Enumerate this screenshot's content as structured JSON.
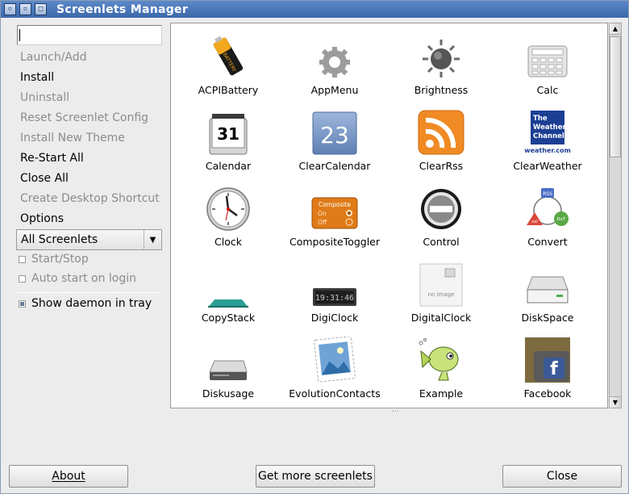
{
  "window": {
    "title": "Screenlets Manager"
  },
  "search": {
    "value": ""
  },
  "actions": [
    {
      "label": "Launch/Add",
      "enabled": false
    },
    {
      "label": "Install",
      "enabled": true
    },
    {
      "label": "Uninstall",
      "enabled": false
    },
    {
      "label": "Reset Screenlet Config",
      "enabled": false
    },
    {
      "label": "Install New Theme",
      "enabled": false
    },
    {
      "label": "Re-Start All",
      "enabled": true
    },
    {
      "label": "Close All",
      "enabled": true
    },
    {
      "label": "Create Desktop Shortcut",
      "enabled": false
    },
    {
      "label": "Options",
      "enabled": true
    }
  ],
  "filter": {
    "selected": "All Screenlets"
  },
  "options": {
    "start_stop": {
      "label": "Start/Stop",
      "checked": false,
      "enabled": false
    },
    "auto_start": {
      "label": "Auto start on login",
      "checked": false,
      "enabled": false
    },
    "show_daemon": {
      "label": "Show daemon in tray",
      "checked": true,
      "enabled": true
    }
  },
  "screenlets": [
    {
      "label": "ACPIBattery",
      "icon": "battery-icon"
    },
    {
      "label": "AppMenu",
      "icon": "gear-icon"
    },
    {
      "label": "Brightness",
      "icon": "sun-icon"
    },
    {
      "label": "Calc",
      "icon": "calculator-icon"
    },
    {
      "label": "Calendar",
      "icon": "calendar-page-icon",
      "icon_text": "31"
    },
    {
      "label": "ClearCalendar",
      "icon": "clear-calendar-icon",
      "icon_text": "23"
    },
    {
      "label": "ClearRss",
      "icon": "rss-icon"
    },
    {
      "label": "ClearWeather",
      "icon": "weather-channel-icon",
      "icon_text": "The Weather Channel",
      "icon_subtext": "weather.com"
    },
    {
      "label": "Clock",
      "icon": "clock-icon"
    },
    {
      "label": "CompositeToggler",
      "icon": "composite-toggle-icon",
      "icon_text": "Composite",
      "icon_on": "On",
      "icon_off": "Off"
    },
    {
      "label": "Control",
      "icon": "minus-circle-icon"
    },
    {
      "label": "Convert",
      "icon": "convert-cycle-icon",
      "icon_a": "RSS",
      "icon_b": "xsl",
      "icon_c": "RxT"
    },
    {
      "label": "CopyStack",
      "icon": "copystack-icon"
    },
    {
      "label": "DigiClock",
      "icon": "digital-display-icon",
      "icon_text": "19:31:46"
    },
    {
      "label": "DigitalClock",
      "icon": "no-image-icon",
      "icon_text": "no image"
    },
    {
      "label": "DiskSpace",
      "icon": "hard-drive-icon"
    },
    {
      "label": "Diskusage",
      "icon": "disk-drive-icon"
    },
    {
      "label": "EvolutionContacts",
      "icon": "stamp-contacts-icon"
    },
    {
      "label": "Example",
      "icon": "fish-icon"
    },
    {
      "label": "Facebook",
      "icon": "facebook-icon",
      "icon_text": "f"
    }
  ],
  "buttons": {
    "about": "About",
    "more": "Get more screenlets",
    "close": "Close"
  },
  "colors": {
    "titlebar": "#3b68ab",
    "rss_orange": "#f08a24",
    "weather_blue": "#1c3f94",
    "facebook_blue": "#3b5998",
    "composite_orange": "#e07b18"
  }
}
